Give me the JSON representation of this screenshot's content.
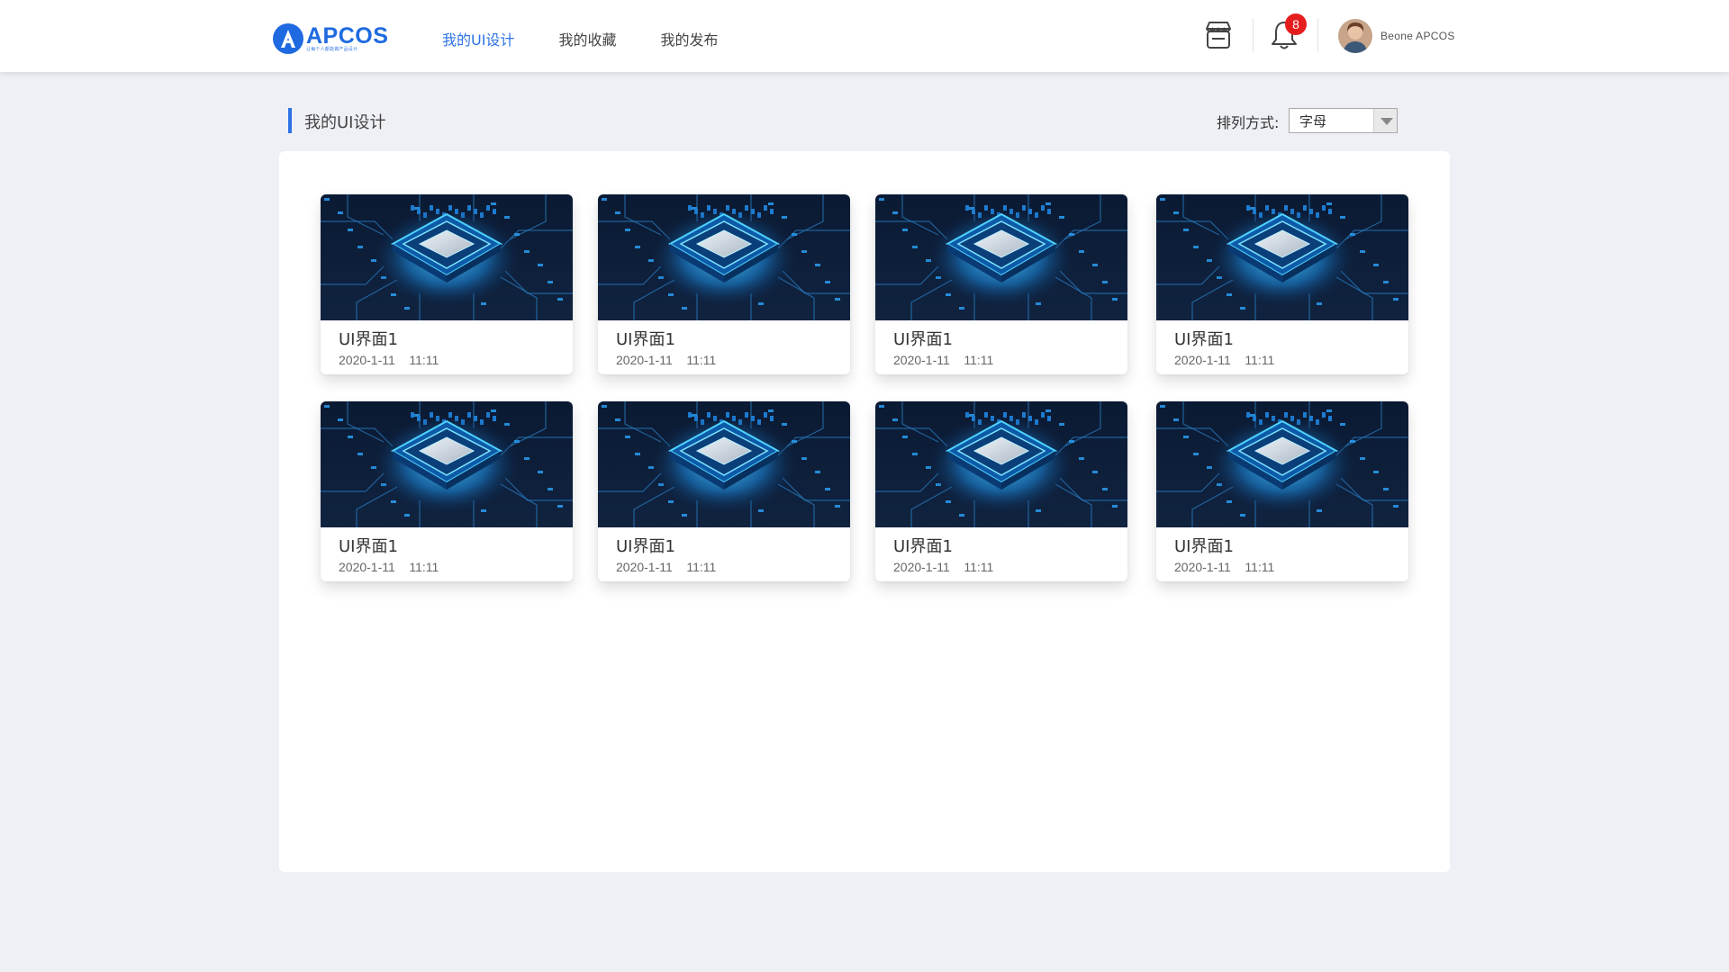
{
  "brand": {
    "name": "APCOS",
    "tagline": "让每个人都能做产品设计",
    "accent": "#2d72e6"
  },
  "nav": {
    "items": [
      {
        "label": "我的UI设计",
        "active": true
      },
      {
        "label": "我的收藏",
        "active": false
      },
      {
        "label": "我的发布",
        "active": false
      }
    ]
  },
  "header": {
    "store_icon": "store-icon",
    "bell_icon": "bell-icon",
    "notification_count": "8",
    "user_name": "Beone APCOS"
  },
  "page": {
    "title": "我的UI设计",
    "sort_label": "排列方式:",
    "sort_value": "字母"
  },
  "cards": [
    {
      "title": "UI界面1",
      "date": "2020-1-11    11:11",
      "thumbnail": "chip-circuit-image"
    },
    {
      "title": "UI界面1",
      "date": "2020-1-11    11:11",
      "thumbnail": "chip-circuit-image"
    },
    {
      "title": "UI界面1",
      "date": "2020-1-11    11:11",
      "thumbnail": "chip-circuit-image"
    },
    {
      "title": "UI界面1",
      "date": "2020-1-11    11:11",
      "thumbnail": "chip-circuit-image"
    },
    {
      "title": "UI界面1",
      "date": "2020-1-11    11:11",
      "thumbnail": "chip-circuit-image"
    },
    {
      "title": "UI界面1",
      "date": "2020-1-11    11:11",
      "thumbnail": "chip-circuit-image"
    },
    {
      "title": "UI界面1",
      "date": "2020-1-11    11:11",
      "thumbnail": "chip-circuit-image"
    },
    {
      "title": "UI界面1",
      "date": "2020-1-11    11:11",
      "thumbnail": "chip-circuit-image"
    }
  ]
}
